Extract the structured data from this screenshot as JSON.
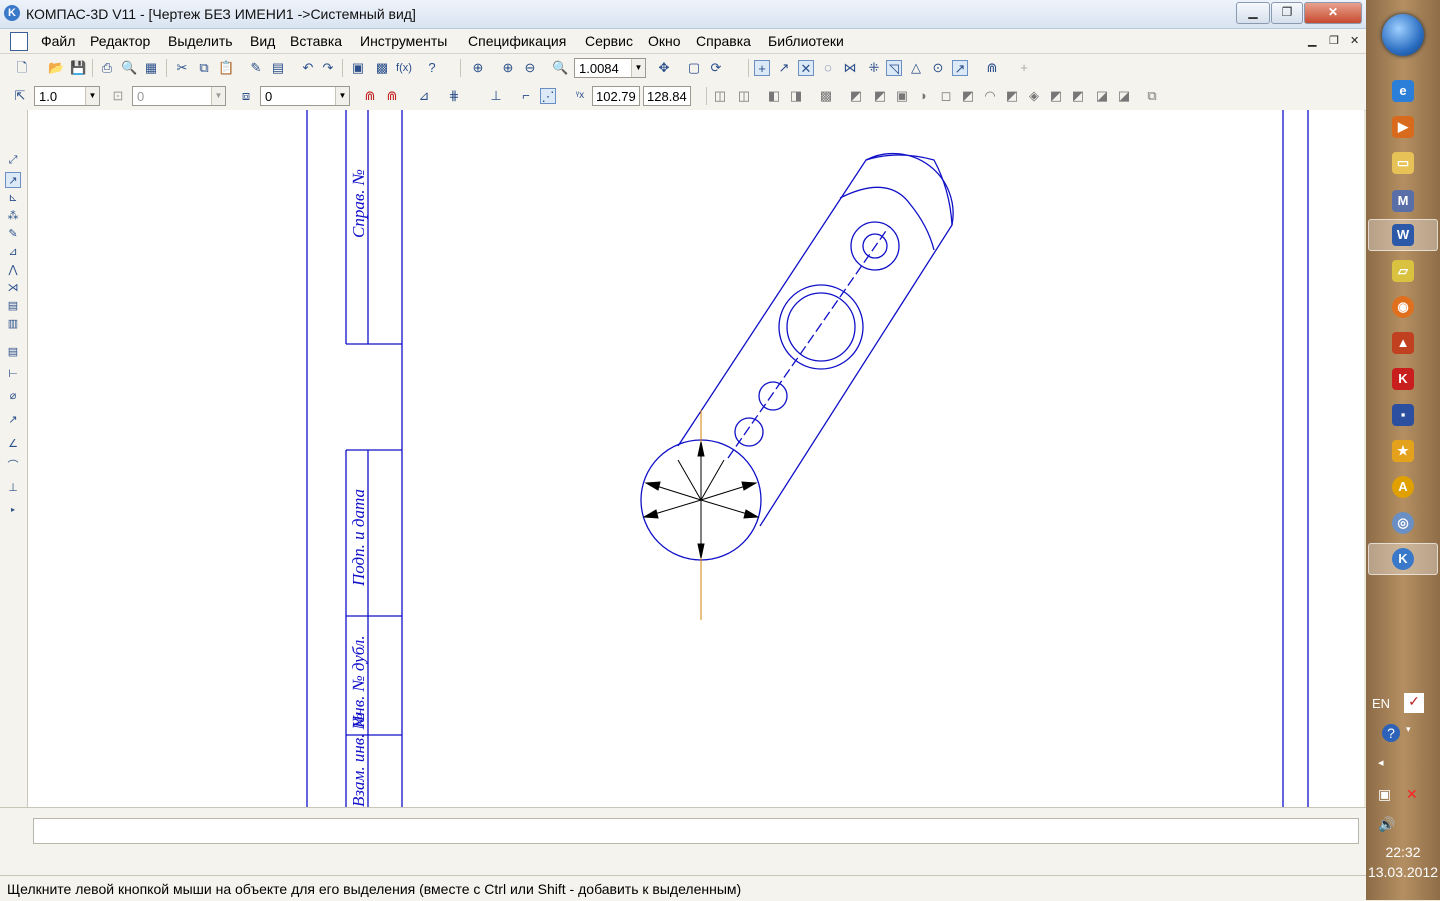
{
  "window": {
    "app_icon": "kompas-logo-icon",
    "title": "КОМПАС-3D V11 - [Чертеж БЕЗ ИМЕНИ1 ->Системный вид]"
  },
  "menu": [
    "Файл",
    "Редактор",
    "Выделить",
    "Вид",
    "Вставка",
    "Инструменты",
    "Спецификация",
    "Сервис",
    "Окно",
    "Справка",
    "Библиотеки"
  ],
  "toolbar1": {
    "zoom_value": "1.0084"
  },
  "toolbar2": {
    "step_value": "1.0",
    "angle_value": "0",
    "layer_value": "0",
    "coord_x": "102.79",
    "coord_y": "128.84"
  },
  "title_block": {
    "sprav_no": "Справ. №",
    "podp_data": "Подп. и дата",
    "inv_dubl": "Инв. № дубл.",
    "vzam_inv": "Взам. инв. №"
  },
  "status": {
    "message": "Щелкните левой кнопкой мыши на объекте для его выделения (вместе с Ctrl или Shift - добавить к выделенным)"
  },
  "taskbar": {
    "language": "EN",
    "time": "22:32",
    "date": "13.03.2012"
  },
  "colors": {
    "drawing_line": "#1010c8",
    "axis_line": "#d08000",
    "frame_line": "#1010c8"
  }
}
